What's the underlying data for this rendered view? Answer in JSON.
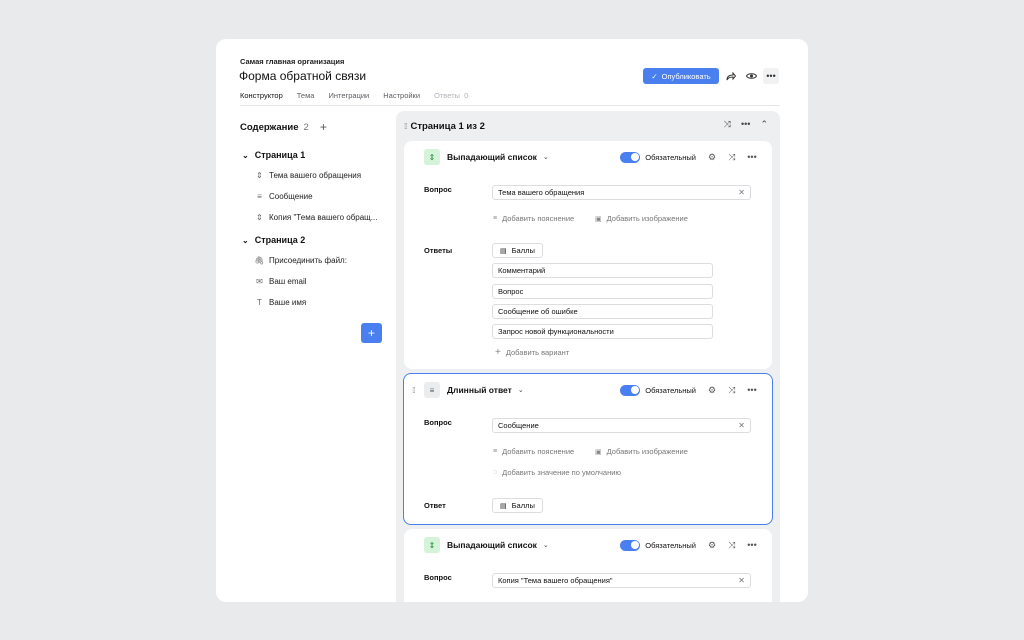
{
  "header": {
    "org": "Самая главная организация",
    "title": "Форма обратной связи",
    "publish_label": "Опубликовать"
  },
  "tabs": [
    {
      "label": "Конструктор"
    },
    {
      "label": "Тема"
    },
    {
      "label": "Интеграции"
    },
    {
      "label": "Настройки"
    },
    {
      "label": "Ответы",
      "count": "0"
    }
  ],
  "sidebar": {
    "title": "Содержание",
    "count": "2",
    "pages": [
      {
        "label": "Страница 1",
        "items": [
          {
            "label": "Тема вашего обращения",
            "icon": "dropdown-icon"
          },
          {
            "label": "Сообщение",
            "icon": "text-lines-icon"
          },
          {
            "label": "Копия \"Тема вашего обращ...",
            "icon": "dropdown-icon"
          }
        ]
      },
      {
        "label": "Страница 2",
        "items": [
          {
            "label": "Присоединить файл:",
            "icon": "paperclip-icon"
          },
          {
            "label": "Ваш email",
            "icon": "email-icon"
          },
          {
            "label": "Ваше имя",
            "icon": "text-t-icon"
          }
        ]
      }
    ]
  },
  "main": {
    "page_title": "Страница 1 из 2",
    "cards": [
      {
        "type_label": "Выпадающий список",
        "required_label": "Обязательный",
        "question_label": "Вопрос",
        "question_value": "Тема вашего обращения",
        "add_hint": "Добавить пояснение",
        "add_image": "Добавить изображение",
        "answers_label": "Ответы",
        "points_label": "Баллы",
        "options": [
          "Комментарий",
          "Вопрос",
          "Сообщение об ошибке",
          "Запрос новой функциональности"
        ],
        "add_option": "Добавить вариант"
      },
      {
        "type_label": "Длинный ответ",
        "required_label": "Обязательный",
        "question_label": "Вопрос",
        "question_value": "Сообщение",
        "add_hint": "Добавить пояснение",
        "add_image": "Добавить изображение",
        "add_default": "Добавить значение по умолчанию",
        "answer_label": "Ответ",
        "points_label": "Баллы"
      },
      {
        "type_label": "Выпадающий список",
        "required_label": "Обязательный",
        "question_label": "Вопрос",
        "question_value": "Копия \"Тема вашего обращения\""
      }
    ]
  },
  "colors": {
    "accent": "#4a7ff0",
    "toggle_on": "#4a7ff0",
    "type_icon_green": "#d4f3d8"
  }
}
